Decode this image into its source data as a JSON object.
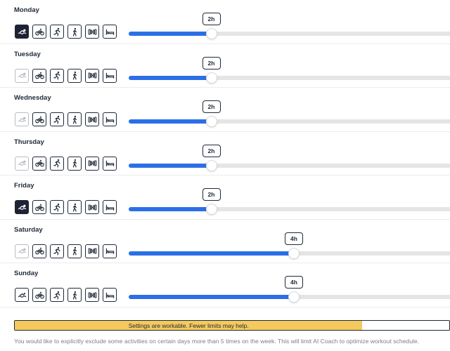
{
  "days": [
    {
      "label": "Monday",
      "value_label": "2h",
      "level": 0.25,
      "activities": [
        "selected",
        "normal",
        "normal",
        "normal",
        "normal",
        "normal"
      ]
    },
    {
      "label": "Tuesday",
      "value_label": "2h",
      "level": 0.25,
      "activities": [
        "dim",
        "normal",
        "normal",
        "normal",
        "normal",
        "normal"
      ]
    },
    {
      "label": "Wednesday",
      "value_label": "2h",
      "level": 0.25,
      "activities": [
        "dim",
        "normal",
        "normal",
        "normal",
        "normal",
        "normal"
      ]
    },
    {
      "label": "Thursday",
      "value_label": "2h",
      "level": 0.25,
      "activities": [
        "dim",
        "normal",
        "normal",
        "normal",
        "normal",
        "normal"
      ]
    },
    {
      "label": "Friday",
      "value_label": "2h",
      "level": 0.25,
      "activities": [
        "selected",
        "normal",
        "normal",
        "normal",
        "normal",
        "normal"
      ]
    },
    {
      "label": "Saturday",
      "value_label": "4h",
      "level": 0.5,
      "activities": [
        "dim",
        "normal",
        "normal",
        "normal",
        "normal",
        "normal"
      ]
    },
    {
      "label": "Sunday",
      "value_label": "4h",
      "level": 0.5,
      "activities": [
        "normal",
        "normal",
        "normal",
        "normal",
        "normal",
        "normal"
      ]
    }
  ],
  "activity_icons": [
    "swim-icon",
    "bike-icon",
    "run-icon",
    "walk-icon",
    "strength-icon",
    "rest-icon"
  ],
  "status": {
    "text": "Settings are workable. Fewer limits may help.",
    "level": 0.8,
    "color": "#f4c95d"
  },
  "note": "You would like to explicitly exclude some activities on certain days more than 5 times on the week. This will limit AI Coach to optimize workout schedule."
}
